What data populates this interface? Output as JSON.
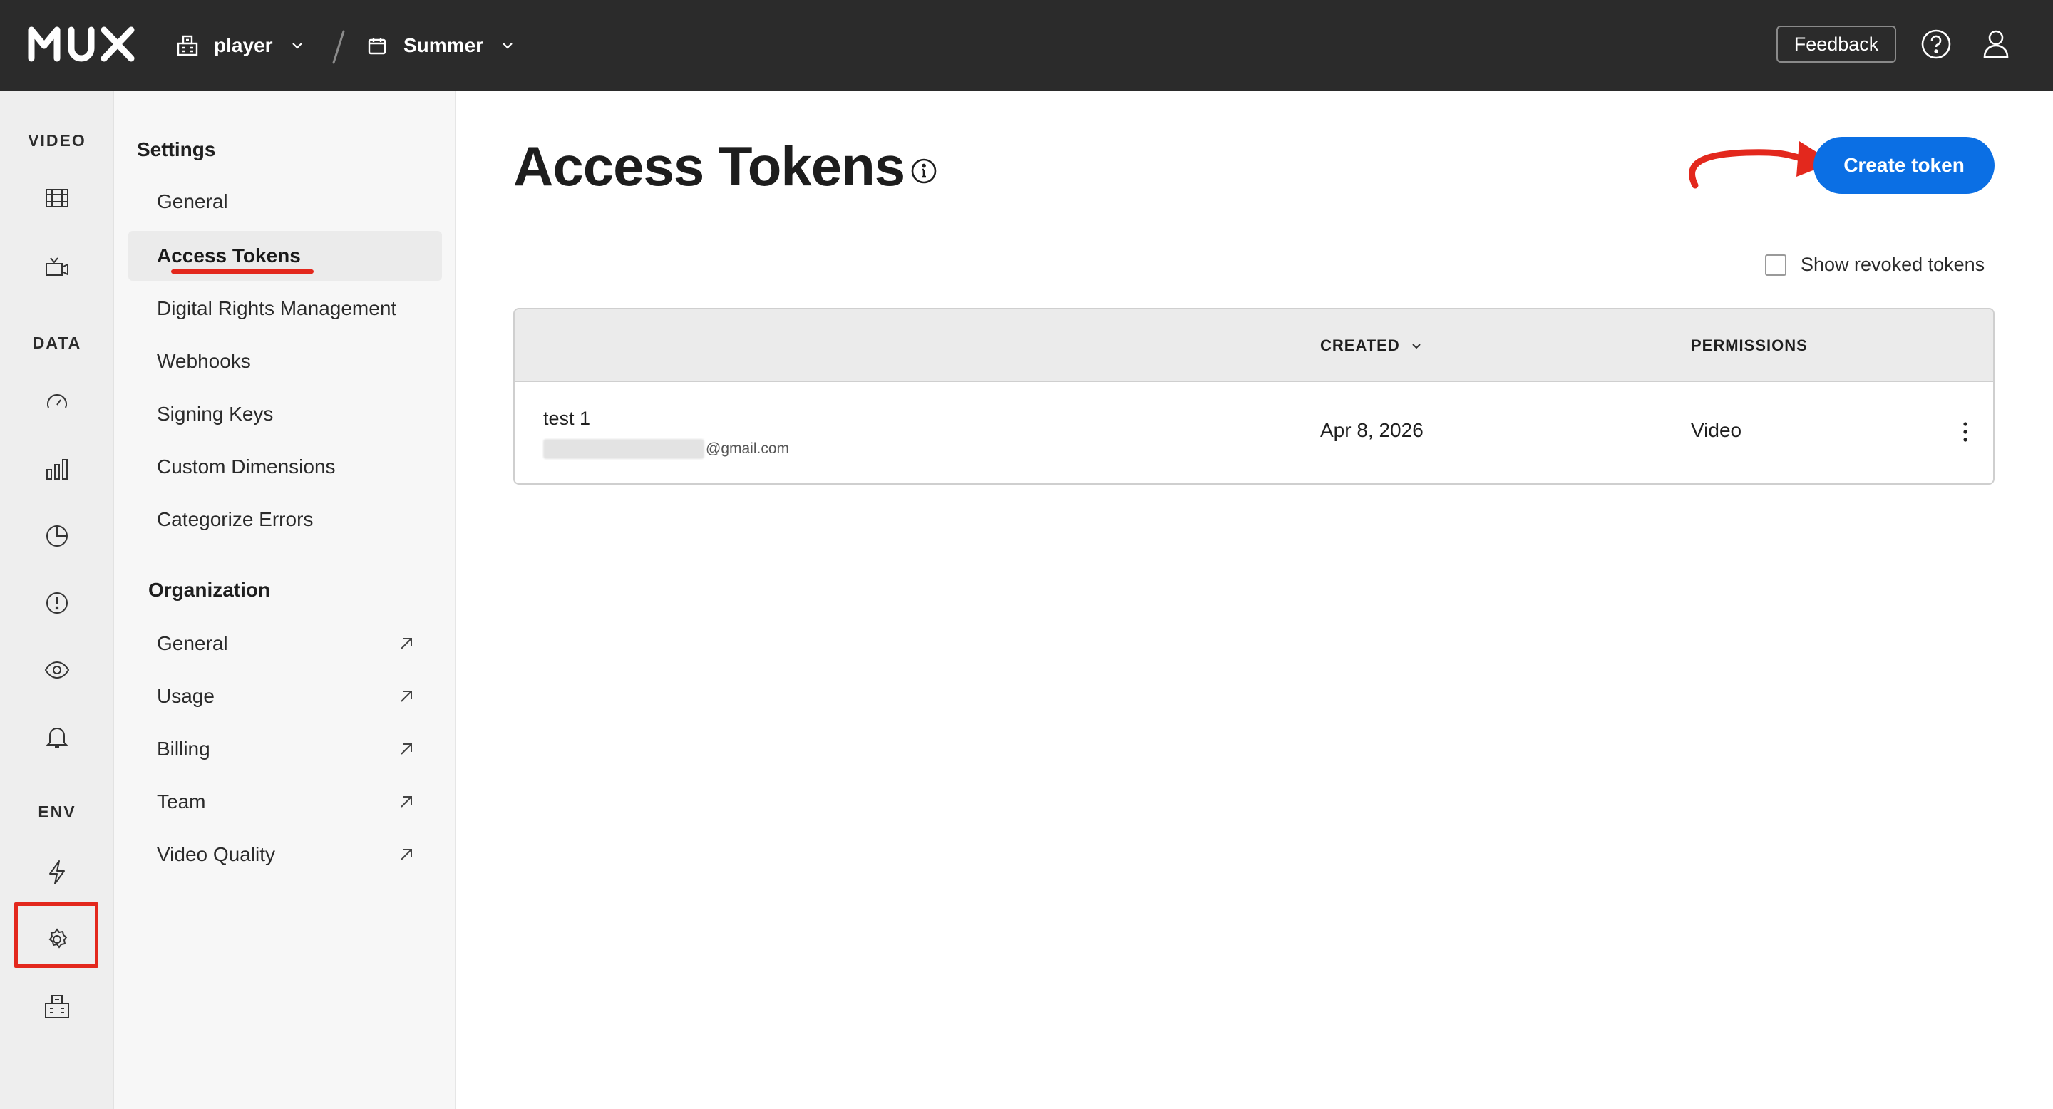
{
  "topbar": {
    "logo": "MUX",
    "workspace": "player",
    "environment": "Summer",
    "feedback_label": "Feedback",
    "help_icon": "help-circle-icon",
    "user_icon": "user-icon"
  },
  "rail": {
    "sections": {
      "video": "VIDEO",
      "data": "DATA",
      "env": "ENV"
    },
    "icons": [
      "assets-icon",
      "live-stream-icon",
      "speedometer-icon",
      "bar-chart-icon",
      "pie-chart-icon",
      "alert-icon",
      "eye-icon",
      "bell-icon",
      "lightning-icon",
      "gear-icon",
      "organization-icon"
    ]
  },
  "subnav": {
    "settings_heading": "Settings",
    "settings_items": [
      {
        "label": "General"
      },
      {
        "label": "Access Tokens"
      },
      {
        "label": "Digital Rights Management"
      },
      {
        "label": "Webhooks"
      },
      {
        "label": "Signing Keys"
      },
      {
        "label": "Custom Dimensions"
      },
      {
        "label": "Categorize Errors"
      }
    ],
    "org_heading": "Organization",
    "org_items": [
      {
        "label": "General"
      },
      {
        "label": "Usage"
      },
      {
        "label": "Billing"
      },
      {
        "label": "Team"
      },
      {
        "label": "Video Quality"
      }
    ]
  },
  "main": {
    "title": "Access Tokens",
    "create_label": "Create token",
    "show_revoked_label": "Show revoked tokens",
    "table": {
      "columns": [
        "",
        "CREATED",
        "PERMISSIONS"
      ],
      "rows": [
        {
          "name": "test 1",
          "email_suffix": "@gmail.com",
          "created": "Apr 8, 2026",
          "permissions": "Video"
        }
      ]
    }
  },
  "colors": {
    "topbar": "#2b2b2b",
    "accent": "#0b6fe4",
    "annotation": "#e3281d"
  }
}
